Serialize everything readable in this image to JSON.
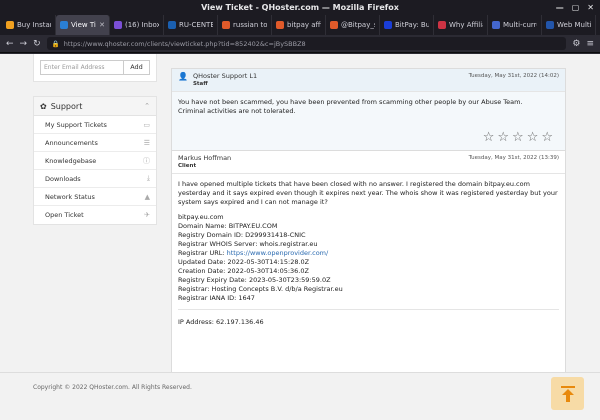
{
  "window": {
    "title": "View Ticket - QHoster.com — Mozilla Firefox"
  },
  "tabs": [
    {
      "label": "Buy Instant K",
      "color": "#f0a020",
      "active": false
    },
    {
      "label": "View Ticke",
      "color": "#2a7fd4",
      "active": true
    },
    {
      "label": "(16) Inbox |",
      "color": "#7b4fd6",
      "active": false
    },
    {
      "label": "RU-CENTER",
      "color": "#1a5fb0",
      "active": false
    },
    {
      "label": "russian to e",
      "color": "#e05a2a",
      "active": false
    },
    {
      "label": "bitpay affilia",
      "color": "#e05a2a",
      "active": false
    },
    {
      "label": "@Bitpay_sea",
      "color": "#e05a2a",
      "active": false
    },
    {
      "label": "BitPay: Buy",
      "color": "#1a3dd6",
      "active": false
    },
    {
      "label": "Why Affiliat",
      "color": "#cc3344",
      "active": false
    },
    {
      "label": "Multi-curre",
      "color": "#4466cc",
      "active": false
    },
    {
      "label": "Web Multi-c",
      "color": "#2255aa",
      "active": false
    }
  ],
  "address": {
    "url": "https://www.qhoster.com/clients/viewticket.php?tid=852402&c=jBySBBZ8"
  },
  "sidebar": {
    "email_placeholder": "Enter Email Address",
    "add_label": "Add",
    "support_title": "Support",
    "items": [
      {
        "label": "My Support Tickets",
        "icon": "ticket-icon"
      },
      {
        "label": "Announcements",
        "icon": "list-icon"
      },
      {
        "label": "Knowledgebase",
        "icon": "info-icon"
      },
      {
        "label": "Downloads",
        "icon": "download-icon"
      },
      {
        "label": "Network Status",
        "icon": "signal-icon"
      },
      {
        "label": "Open Ticket",
        "icon": "rocket-icon"
      }
    ]
  },
  "staff_reply": {
    "name": "QHoster Support L1",
    "role": "Staff",
    "date": "Tuesday, May 31st, 2022 (14:02)",
    "line1": "You have not been scammed, you have been prevented from scamming other people by our Abuse Team.",
    "line2": "Criminal activities are not tolerated.",
    "rating_stars": 5
  },
  "client_reply": {
    "name": "Markus Hoffman",
    "role": "Client",
    "date": "Tuesday, May 31st, 2022 (13:39)",
    "message": "I have opened multiple tickets that have been closed with no answer. I registered the domain bitpay.eu.com yesterday and it says expired even though it expires next year. The whois show it was registered yesterday but your system says expired and I can not manage it?",
    "whois": {
      "domain": "bitpay.eu.com",
      "domain_name": "Domain Name: BITPAY.EU.COM",
      "registry_id": "Registry Domain ID: D299931418-CNIC",
      "whois_server": "Registrar WHOIS Server: whois.registrar.eu",
      "registrar_url_label": "Registrar URL: ",
      "registrar_url": "https://www.openprovider.com/",
      "updated": "Updated Date: 2022-05-30T14:15:28.0Z",
      "created": "Creation Date: 2022-05-30T14:05:36.0Z",
      "expiry": "Registry Expiry Date: 2023-05-30T23:59:59.0Z",
      "registrar": "Registrar: Hosting Concepts B.V. d/b/a Registrar.eu",
      "iana": "Registrar IANA ID: 1647"
    },
    "ip": "IP Address: 62.197.136.46"
  },
  "footer": {
    "copyright": "Copyright © 2022 QHoster.com. All Rights Reserved."
  }
}
